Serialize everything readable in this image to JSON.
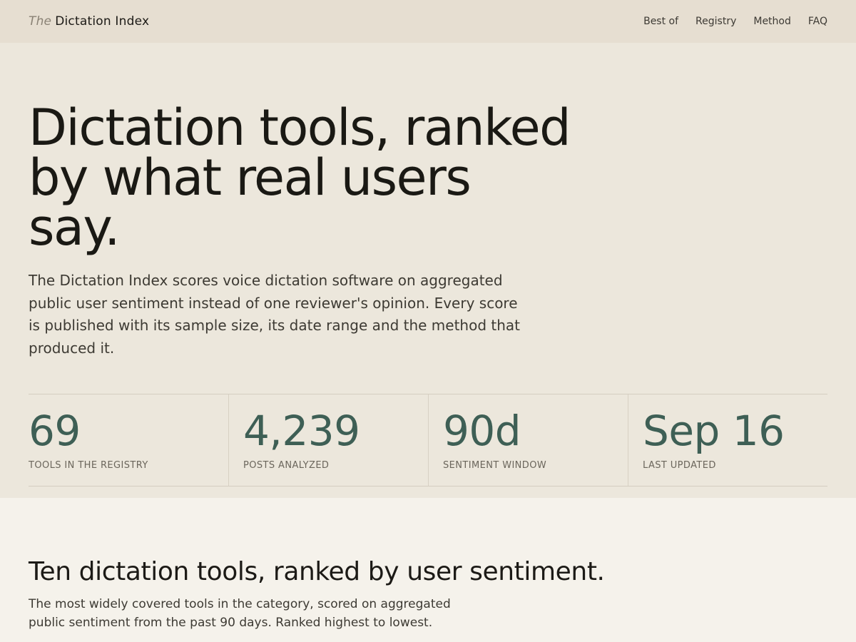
{
  "brand": {
    "the": "The",
    "name": "Dictation Index"
  },
  "nav": [
    "Best of",
    "Registry",
    "Method",
    "FAQ"
  ],
  "hero": {
    "title_line1": "Dictation tools, ranked",
    "title_line2": "by what real users say.",
    "lead": "The Dictation Index scores voice dictation software on aggregated public user sentiment instead of one reviewer's opinion. Every score is published with its sample size, its date range and the method that produced it."
  },
  "stats": [
    {
      "value": "69",
      "label": "TOOLS IN THE REGISTRY"
    },
    {
      "value": "4,239",
      "label": "POSTS ANALYZED"
    },
    {
      "value": "90d",
      "label": "SENTIMENT WINDOW"
    },
    {
      "value": "Sep 16",
      "label": "LAST UPDATED"
    }
  ],
  "ranking": {
    "title": "Ten dictation tools, ranked by user sentiment.",
    "lead": "The most widely covered tools in the category, scored on aggregated public sentiment from the past 90 days. Ranked highest to lowest."
  },
  "colors": {
    "accent": "#3e5f55",
    "header_bg": "#e6ded1",
    "hero_bg": "#ece7dc",
    "section_bg": "#f5f2eb"
  }
}
